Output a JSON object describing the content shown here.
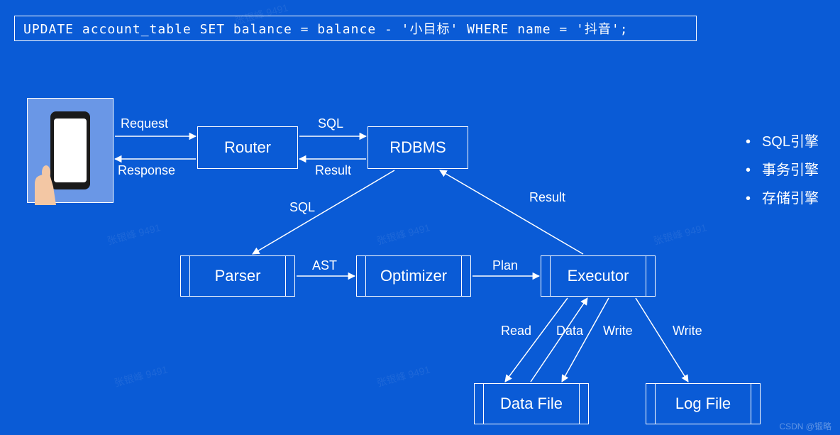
{
  "sql": "UPDATE account_table SET balance = balance - '小目标' WHERE name = '抖音';",
  "nodes": {
    "router": "Router",
    "rdbms": "RDBMS",
    "parser": "Parser",
    "optimizer": "Optimizer",
    "executor": "Executor",
    "datafile": "Data File",
    "logfile": "Log File"
  },
  "edges": {
    "request": "Request",
    "response": "Response",
    "sql1": "SQL",
    "result1": "Result",
    "sql2": "SQL",
    "result2": "Result",
    "ast": "AST",
    "plan": "Plan",
    "read": "Read",
    "data": "Data",
    "write1": "Write",
    "write2": "Write"
  },
  "bullets": [
    "SQL引擎",
    "事务引擎",
    "存储引擎"
  ],
  "watermark": "张银峰 9491",
  "credit": "CSDN @锻略"
}
